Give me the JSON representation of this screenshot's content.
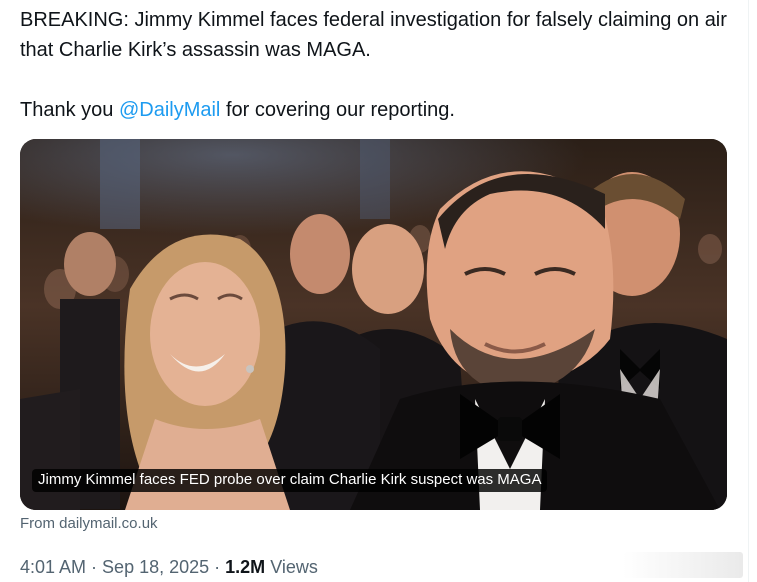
{
  "tweet": {
    "text_line1": "BREAKING: Jimmy Kimmel faces federal investigation for falsely claiming on air that Charlie Kirk’s assassin was MAGA.",
    "thanks_prefix": "Thank you ",
    "mention": "@DailyMail",
    "thanks_suffix": " for covering our reporting."
  },
  "card": {
    "caption": "Jimmy Kimmel faces FED probe over claim Charlie Kirk suspect was MAGA",
    "source": "From dailymail.co.uk"
  },
  "meta": {
    "time": "4:01 AM",
    "separator": " · ",
    "date": "Sep 18, 2025",
    "views_count": "1.2M",
    "views_label": " Views"
  },
  "colors": {
    "link": "#1d9bf0",
    "secondary_text": "#536471",
    "primary_text": "#0f1419"
  }
}
